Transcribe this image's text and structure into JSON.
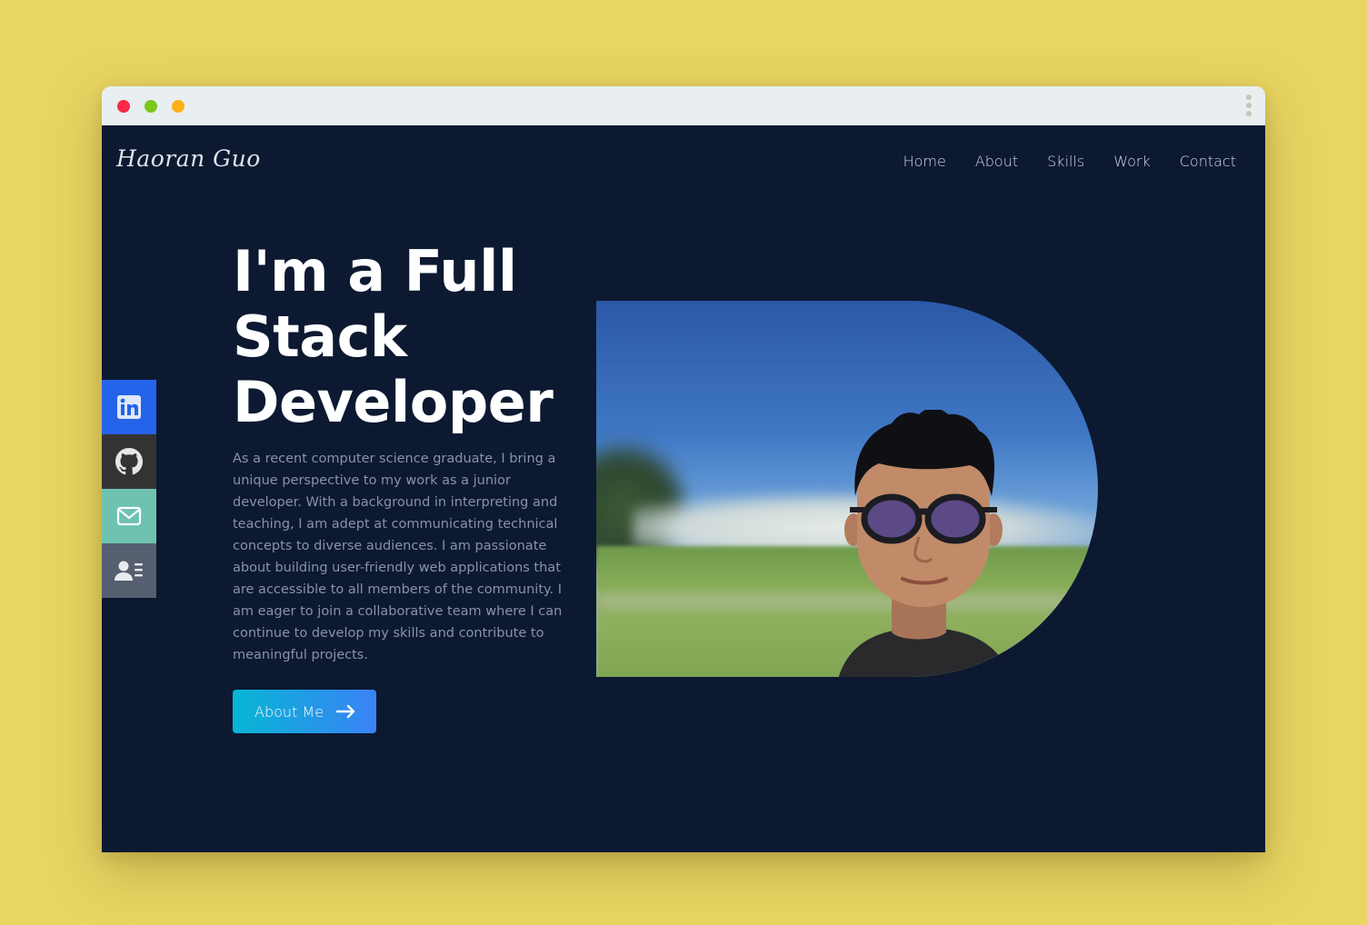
{
  "brand": {
    "name": "Haoran Guo"
  },
  "nav": {
    "items": [
      {
        "label": "Home"
      },
      {
        "label": "About"
      },
      {
        "label": "Skills"
      },
      {
        "label": "Work"
      },
      {
        "label": "Contact"
      }
    ]
  },
  "hero": {
    "title_line1": "I'm a Full",
    "title_line2": "Stack",
    "title_line3": "Developer",
    "description": "As a recent computer science graduate, I bring a unique perspective to my work as a junior developer. With a background in interpreting and teaching, I am adept at communicating technical concepts to diverse audiences. I am passionate about building user-friendly web applications that are accessible to all members of the community. I am eager to join a collaborative team where I can continue to develop my skills and contribute to meaningful projects.",
    "cta_label": "About Me"
  },
  "social": [
    {
      "icon": "linkedin-icon",
      "color": "#2563eb"
    },
    {
      "icon": "github-icon",
      "color": "#333333"
    },
    {
      "icon": "mail-icon",
      "color": "#6fc2b0"
    },
    {
      "icon": "resume-icon",
      "color": "#565f70"
    }
  ],
  "colors": {
    "background": "#e8d563",
    "page": "#0c1931",
    "accent_start": "#06b6d4",
    "accent_end": "#3b82f6"
  }
}
